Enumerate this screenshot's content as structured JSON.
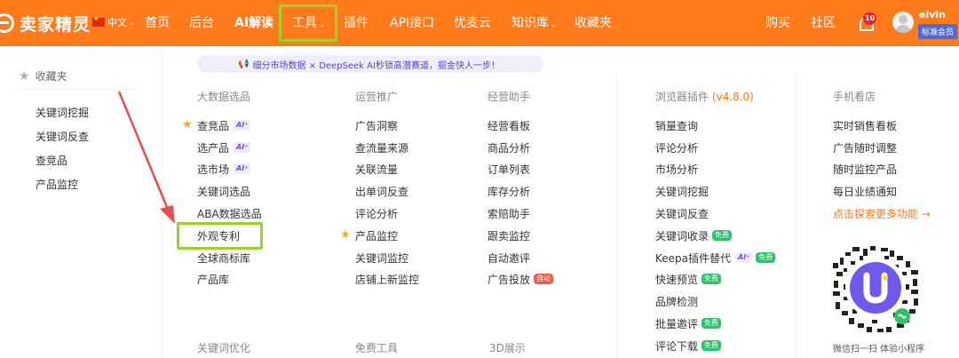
{
  "brand": {
    "name": "卖家精灵"
  },
  "nav": {
    "language": "中文",
    "items": [
      "首页",
      "后台",
      "AI解读",
      "工具",
      "插件",
      "API接口",
      "优麦云",
      "知识库",
      "收藏夹"
    ],
    "tools_caret": "⌄",
    "kb_caret": "⌄",
    "right": [
      "购买",
      "社区"
    ],
    "notification_count": "10",
    "username": "elvin",
    "membership": "标准会员"
  },
  "sidebar": {
    "title": "收藏夹",
    "items": [
      "关键词挖掘",
      "关键词反查",
      "查竞品",
      "产品监控"
    ]
  },
  "banner": {
    "text": "细分市场数据 × DeepSeek AI秒锁高潜赛道，掘金快人一步！"
  },
  "columns": {
    "big_data": {
      "title": "大数据选品",
      "items": [
        "查竞品",
        "选产品",
        "选市场",
        "关键词选品",
        "ABA数据选品",
        "外观专利",
        "全球商标库",
        "产品库"
      ]
    },
    "operations": {
      "title": "运营推广",
      "items": [
        "广告洞察",
        "查流量来源",
        "关联流量",
        "出单词反查",
        "评论分析",
        "产品监控",
        "关键词监控",
        "店铺上新监控"
      ]
    },
    "business": {
      "title": "经营助手",
      "items": [
        "经营看板",
        "商品分析",
        "订单列表",
        "库存分析",
        "索赔助手",
        "跟卖监控",
        "自动邀评",
        "广告投放"
      ]
    },
    "plugin": {
      "title": "浏览器插件",
      "version": "(v4.8.0)",
      "items": [
        "销量查询",
        "评论分析",
        "市场分析",
        "关键词挖掘",
        "关键词反查",
        "关键词收录",
        "Keepa插件替代",
        "快速预览",
        "品牌检测",
        "批量邀评",
        "评论下载"
      ]
    },
    "mobile": {
      "title": "手机看店",
      "items": [
        "实时销售看板",
        "广告随时调整",
        "随时监控产品",
        "每日业绩通知"
      ],
      "explore": "点击探索更多功能 →",
      "qr_caption": "微信扫一扫 体验小程序"
    },
    "bottom_heads": [
      "关键词优化",
      "免费工具",
      "3D展示"
    ]
  },
  "tags": {
    "ai": "AI⁺",
    "free": "免费",
    "ad": "自动"
  },
  "colors": {
    "topbar": "#ff7a1a",
    "highlight": "#9ad12c",
    "arrow": "#e94d4d"
  }
}
